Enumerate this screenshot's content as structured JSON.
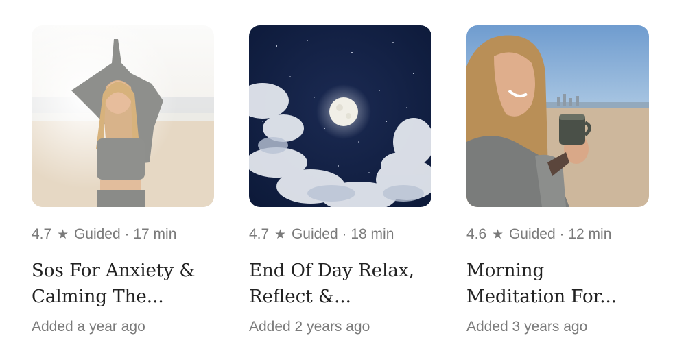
{
  "cards": [
    {
      "rating": "4.7",
      "star_icon": "star-icon",
      "type": "Guided",
      "separator": "·",
      "duration": "17 min",
      "title_line1": "Sos For Anxiety &",
      "title_line2": "Calming The...",
      "added": "Added a year ago"
    },
    {
      "rating": "4.7",
      "star_icon": "star-icon",
      "type": "Guided",
      "separator": "·",
      "duration": "18 min",
      "title_line1": "End Of Day Relax,",
      "title_line2": "Reflect &...",
      "added": "Added 2 years ago"
    },
    {
      "rating": "4.6",
      "star_icon": "star-icon",
      "type": "Guided",
      "separator": "·",
      "duration": "12 min",
      "title_line1": "Morning",
      "title_line2": "Meditation For...",
      "added": "Added 3 years ago"
    }
  ],
  "colors": {
    "meta_text": "#7a7a7a",
    "title_text": "#222222",
    "night_sky": "#0d1a3a"
  }
}
